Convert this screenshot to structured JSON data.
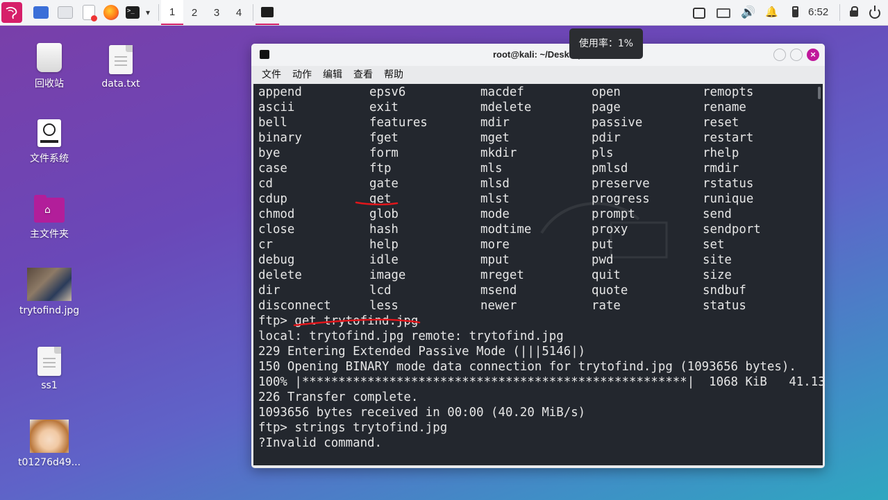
{
  "panel": {
    "workspaces": [
      "1",
      "2",
      "3",
      "4"
    ],
    "active_workspace": "1",
    "clock": "6:52"
  },
  "tooltip": {
    "text": "使用率：1%"
  },
  "desktop": {
    "icons": [
      {
        "label": "回收站"
      },
      {
        "label": "data.txt"
      },
      {
        "label": "文件系统"
      },
      {
        "label": "主文件夹"
      },
      {
        "label": "trytofind.jpg"
      },
      {
        "label": "ss1"
      },
      {
        "label": "t01276d49..."
      }
    ]
  },
  "window": {
    "title": "root@kali: ~/Desktop",
    "menu": [
      "文件",
      "动作",
      "编辑",
      "查看",
      "帮助"
    ]
  },
  "terminal": {
    "commands": [
      [
        "append",
        "epsv6",
        "macdef",
        "open",
        "remopts"
      ],
      [
        "ascii",
        "exit",
        "mdelete",
        "page",
        "rename"
      ],
      [
        "bell",
        "features",
        "mdir",
        "passive",
        "reset"
      ],
      [
        "binary",
        "fget",
        "mget",
        "pdir",
        "restart"
      ],
      [
        "bye",
        "form",
        "mkdir",
        "pls",
        "rhelp"
      ],
      [
        "case",
        "ftp",
        "mls",
        "pmlsd",
        "rmdir"
      ],
      [
        "cd",
        "gate",
        "mlsd",
        "preserve",
        "rstatus"
      ],
      [
        "cdup",
        "get",
        "mlst",
        "progress",
        "runique"
      ],
      [
        "chmod",
        "glob",
        "mode",
        "prompt",
        "send"
      ],
      [
        "close",
        "hash",
        "modtime",
        "proxy",
        "sendport"
      ],
      [
        "cr",
        "help",
        "more",
        "put",
        "set"
      ],
      [
        "debug",
        "idle",
        "mput",
        "pwd",
        "site"
      ],
      [
        "delete",
        "image",
        "mreget",
        "quit",
        "size"
      ],
      [
        "dir",
        "lcd",
        "msend",
        "quote",
        "sndbuf"
      ],
      [
        "disconnect",
        "less",
        "newer",
        "rate",
        "status"
      ]
    ],
    "output": [
      "ftp> get trytofind.jpg",
      "local: trytofind.jpg remote: trytofind.jpg",
      "229 Entering Extended Passive Mode (|||5146|)",
      "150 Opening BINARY mode data connection for trytofind.jpg (1093656 bytes).",
      "100% |*****************************************************|  1068 KiB   41.13",
      "226 Transfer complete.",
      "1093656 bytes received in 00:00 (40.20 MiB/s)",
      "ftp> strings trytofind.jpg",
      "?Invalid command."
    ]
  }
}
